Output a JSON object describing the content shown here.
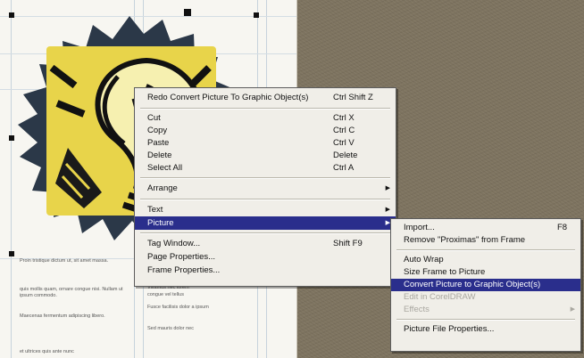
{
  "context_menu": {
    "items": [
      {
        "label": "Redo Convert Picture To Graphic Object(s)",
        "shortcut": "Ctrl Shift Z"
      },
      {
        "label": "Cut",
        "shortcut": "Ctrl X"
      },
      {
        "label": "Copy",
        "shortcut": "Ctrl C"
      },
      {
        "label": "Paste",
        "shortcut": "Ctrl V"
      },
      {
        "label": "Delete",
        "shortcut": "Delete"
      },
      {
        "label": "Select All",
        "shortcut": "Ctrl A"
      },
      {
        "label": "Arrange",
        "arrow": "▶"
      },
      {
        "label": "Text",
        "arrow": "▶"
      },
      {
        "label": "Picture",
        "arrow": "▶"
      },
      {
        "label": "Tag Window...",
        "shortcut": "Shift F9"
      },
      {
        "label": "Page Properties..."
      },
      {
        "label": "Frame Properties..."
      }
    ]
  },
  "picture_submenu": {
    "items": [
      {
        "label": "Import...",
        "shortcut": "F8"
      },
      {
        "label": "Remove \"Proximas\" from Frame"
      },
      {
        "label": "Auto Wrap"
      },
      {
        "label": "Size Frame to Picture"
      },
      {
        "label": "Convert Picture to Graphic Object(s)"
      },
      {
        "label": "Edit in CorelDRAW"
      },
      {
        "label": "Effects",
        "arrow": "▶"
      },
      {
        "label": "Picture File Properties..."
      }
    ]
  },
  "document": {
    "para1": "Proin tristique dictum ut, sit amet massa.",
    "para2": "quis mollis quam, ornare congue nisi. Nullam ut ipsum commodo.",
    "para3": "Maecenas fermentum adipiscing libero.",
    "para4": "et ultrices quis ante nunc",
    "col2_line1": "Vivamus nec lorem",
    "col2_line2": "congue vel tellus",
    "col2_line3": "Fusce facilisis dolor a ipsum",
    "col2_line4": "Sed mauris dolor nec"
  }
}
